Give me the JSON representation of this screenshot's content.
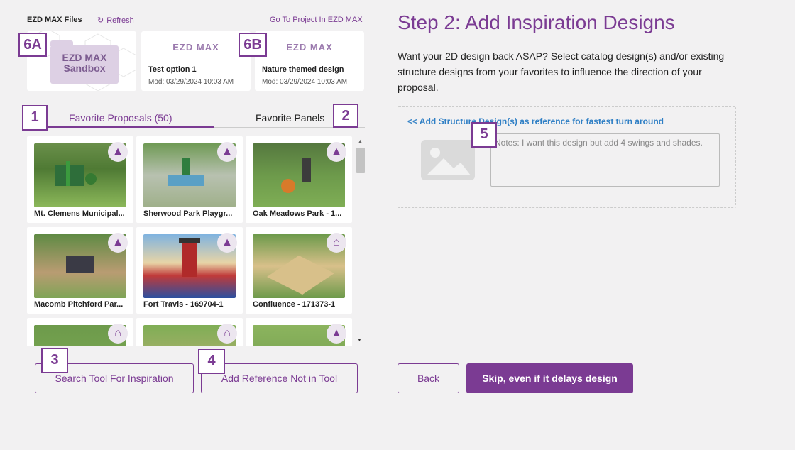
{
  "files": {
    "title": "EZD MAX Files",
    "refresh_label": "Refresh",
    "goto_label": "Go To Project In EZD MAX",
    "sandbox_label_line1": "EZD MAX",
    "sandbox_label_line2": "Sandbox",
    "cards": [
      {
        "logo": "EZD MAX",
        "name": "Test option 1",
        "mod": "Mod: 03/29/2024 10:03 AM"
      },
      {
        "logo": "EZD MAX",
        "name": "Nature themed design",
        "mod": "Mod: 03/29/2024 10:03 AM"
      }
    ]
  },
  "tabs": {
    "favorites": "Favorite Proposals (50)",
    "panels": "Favorite Panels"
  },
  "proposals": [
    {
      "label": "Mt. Clemens Municipal...",
      "badge": "tree-icon"
    },
    {
      "label": "Sherwood Park Playgr...",
      "badge": "tree-icon"
    },
    {
      "label": "Oak Meadows Park - 1...",
      "badge": "tree-icon"
    },
    {
      "label": "Macomb Pitchford Par...",
      "badge": "tree-icon"
    },
    {
      "label": "Fort Travis - 169704-1",
      "badge": "tree-icon"
    },
    {
      "label": "Confluence - 171373-1",
      "badge": "home-icon"
    },
    {
      "label": "",
      "badge": "home-icon"
    },
    {
      "label": "",
      "badge": "home-icon"
    },
    {
      "label": "",
      "badge": "tree-icon"
    }
  ],
  "callouts": {
    "c1": "1",
    "c2": "2",
    "c3": "3",
    "c4": "4",
    "c5": "5",
    "c6a": "6A",
    "c6b": "6B"
  },
  "buttons": {
    "search": "Search Tool For Inspiration",
    "add_reference": "Add Reference Not in Tool",
    "back": "Back",
    "skip": "Skip, even if it delays design"
  },
  "step": {
    "title": "Step 2: Add Inspiration Designs",
    "description": "Want your 2D design back ASAP? Select catalog design(s) and/or existing structure designs from your favorites to influence the direction of your proposal.",
    "add_link": "<< Add Structure Design(s) as reference for fastest turn around",
    "notes_placeholder": "Notes: I want this design but add 4 swings and shades."
  },
  "colors": {
    "accent": "#7b3b93",
    "link": "#2f7fc5"
  }
}
